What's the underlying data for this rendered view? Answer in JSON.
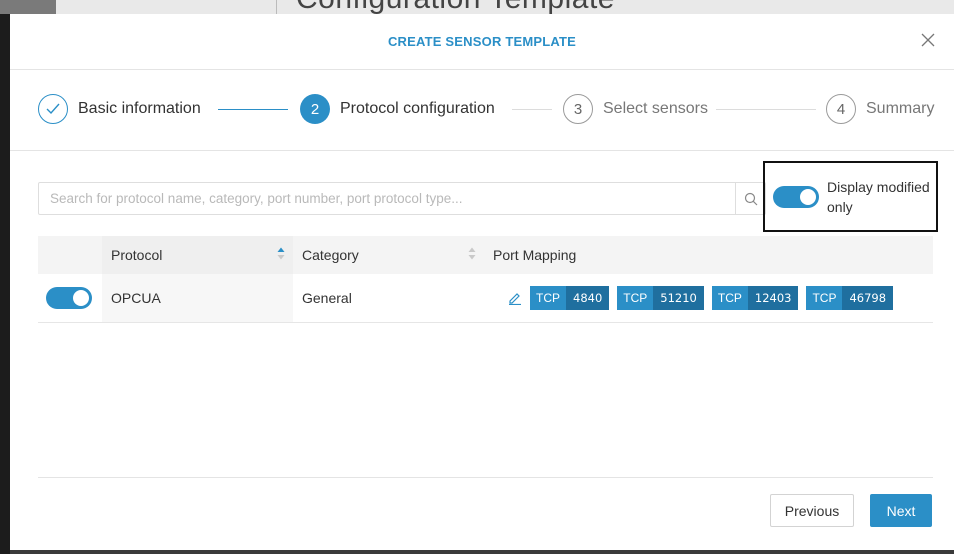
{
  "background": {
    "page_title": "Configuration Template"
  },
  "modal": {
    "title": "CREATE SENSOR TEMPLATE",
    "steps": [
      {
        "number": "✓",
        "label": "Basic information",
        "state": "done"
      },
      {
        "number": "2",
        "label": "Protocol configuration",
        "state": "active"
      },
      {
        "number": "3",
        "label": "Select sensors",
        "state": "todo"
      },
      {
        "number": "4",
        "label": "Summary",
        "state": "todo"
      }
    ],
    "search": {
      "placeholder": "Search for protocol name, category, port number, port protocol type...",
      "value": ""
    },
    "filter": {
      "label": "Display modified only",
      "enabled": true
    },
    "table": {
      "headers": [
        "Protocol",
        "Category",
        "Port Mapping"
      ],
      "rows": [
        {
          "enabled": true,
          "protocol": "OPCUA",
          "category": "General",
          "ports": [
            {
              "proto": "TCP",
              "port": "4840"
            },
            {
              "proto": "TCP",
              "port": "51210"
            },
            {
              "proto": "TCP",
              "port": "12403"
            },
            {
              "proto": "TCP",
              "port": "46798"
            }
          ]
        }
      ]
    },
    "buttons": {
      "previous": "Previous",
      "next": "Next"
    }
  },
  "colors": {
    "accent": "#2b8fc7",
    "accent_dark": "#1f6f9f"
  },
  "icons": {
    "close": "close-icon",
    "search": "search-icon",
    "sort": "sort-icon",
    "edit": "pencil-icon",
    "check": "check-icon"
  }
}
